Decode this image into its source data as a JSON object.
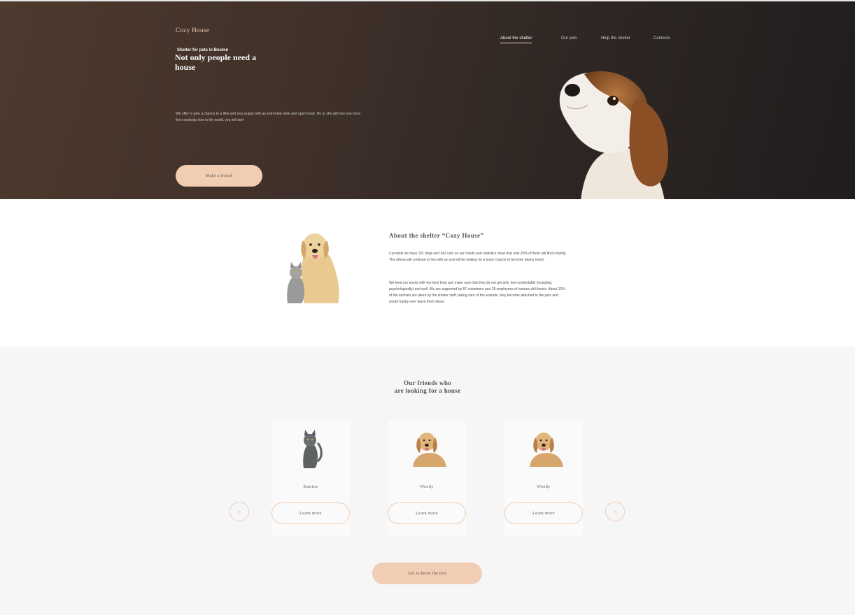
{
  "header": {
    "logo": "Cozy House",
    "nav": [
      {
        "label": "About the shelter",
        "active": true
      },
      {
        "label": "Our pets",
        "active": false
      },
      {
        "label": "Help the shelter",
        "active": false
      },
      {
        "label": "Contects",
        "active": false
      }
    ]
  },
  "hero": {
    "subtitle": "Shelter for pets in Boston",
    "title": "Not only people need a house",
    "text": "We offer to give a chance to a little and nice puppy with an extremely wide and open heart. He or she will love you more then anybody else in the world, you will see!",
    "button": "Make a friend"
  },
  "about": {
    "title": "About the shelter “Cozy House”",
    "p1": "Currently we have 121 dogs and 342 cats on our hands and statistics show that only 20% of them will find a family. The others will continue to live with us and will be waiting for a lucky chance to become dearly loved.",
    "p2": "We feed our wards with the best food and make sure that they do not get sick, feel comfortable (including psychologically) and well. We are supported by 87 volunteers and 28 employees of various skill levels. About 12% of the animals are taken by the shelter staff, taking care of the animals, they become attached to the pets and would hardly ever leave them alone."
  },
  "pets": {
    "title_line1": "Our friends who",
    "title_line2": "are looking for a house",
    "cards": [
      {
        "name": "Katrine",
        "button": "Learn more",
        "icon": "cat-icon"
      },
      {
        "name": "Woody",
        "button": "Learn more",
        "icon": "dog-icon"
      },
      {
        "name": "Woody",
        "button": "Learn more",
        "icon": "dog-icon"
      }
    ],
    "prev": "←",
    "next": "→",
    "button": "Get to know the rest"
  },
  "colors": {
    "accent": "#f1cdb3",
    "dark": "#545454",
    "light_bg": "#f6f6f6"
  }
}
